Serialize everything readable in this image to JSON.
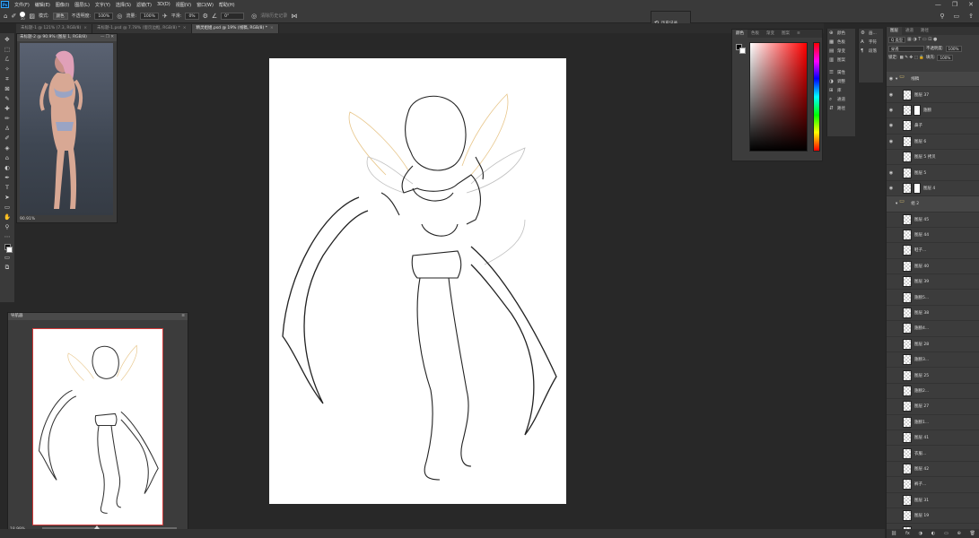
{
  "app": {
    "logo": "Ps",
    "window_controls": [
      "—",
      "❐",
      "✕"
    ]
  },
  "menu": [
    "文件(F)",
    "编辑(E)",
    "图像(I)",
    "图层(L)",
    "文字(Y)",
    "选择(S)",
    "滤镜(T)",
    "3D(D)",
    "视图(V)",
    "窗口(W)",
    "帮助(H)"
  ],
  "options": {
    "brush_size": "20",
    "mode_label": "模式:",
    "mode_value": "颜色",
    "opacity_label": "不透明度:",
    "opacity_value": "100%",
    "flow_label": "流量:",
    "flow_value": "100%",
    "smooth_label": "平滑:",
    "smooth_value": "0%",
    "angle_value": "0°",
    "extra_label": "清除历史记录"
  },
  "tabs": [
    {
      "label": "未标题-1 @ 121% (7.3, RGB/8)",
      "close": "×"
    },
    {
      "label": "未标题-1.psd @ 7.78% (窗页边框, RGB/8) *",
      "close": "×"
    },
    {
      "label": "精灵姐姐.psd @ 19% (线稿, RGB/8) *",
      "close": "×"
    }
  ],
  "toolbar_icons": [
    "✥",
    "⬚",
    "ℒ",
    "✧",
    "⌗",
    "⊠",
    "✎",
    "✚",
    "✏",
    "♙",
    "✐",
    "◈",
    "⌂",
    "◐",
    "✒",
    "T",
    "➤",
    "▭",
    "✋",
    "⚲",
    "⋯"
  ],
  "reference_window": {
    "title": "未标题-2 @ 90.9% (图层 1, RGB/8)",
    "zoom": "90.91%"
  },
  "navigator": {
    "title": "导航器",
    "zoom": "18.99%"
  },
  "history_panel": {
    "label": "历史记录",
    "icon": "history-icon"
  },
  "color_panel": {
    "tabs": [
      "颜色",
      "色板",
      "渐变",
      "图案"
    ],
    "fg_color": "#000000",
    "bg_color": "#ffffff",
    "hue_color": "#ff0000"
  },
  "dock_panels": [
    {
      "icon": "⊕",
      "label": "颜色"
    },
    {
      "icon": "▦",
      "label": "色板"
    },
    {
      "icon": "▤",
      "label": "渐变"
    },
    {
      "icon": "▥",
      "label": "图案"
    },
    {
      "icon": "☰",
      "label": "属性"
    },
    {
      "icon": "◑",
      "label": "调整"
    },
    {
      "icon": "⊞",
      "label": "库"
    },
    {
      "icon": "⌕",
      "label": "通道"
    },
    {
      "icon": "⇵",
      "label": "路径"
    }
  ],
  "dock2_panels": [
    {
      "icon": "⚙",
      "label": "画..."
    },
    {
      "icon": "A",
      "label": "字符"
    },
    {
      "icon": "¶",
      "label": "段落"
    }
  ],
  "layers_panel": {
    "tabs": [
      "图层",
      "通道",
      "路径"
    ],
    "filter_label": "Q 类型",
    "blend_mode": "穿透",
    "opacity_label": "不透明度:",
    "opacity_value": "100%",
    "lock_label": "锁定:",
    "fill_label": "填充:",
    "fill_value": "100%",
    "layers": [
      {
        "name": "线稿",
        "type": "group",
        "visible": true
      },
      {
        "name": "图层 37",
        "type": "layer",
        "visible": true,
        "mask": false
      },
      {
        "name": "翅膀",
        "type": "layer",
        "visible": true,
        "mask": true
      },
      {
        "name": "鼻子",
        "type": "layer",
        "visible": true,
        "mask": false
      },
      {
        "name": "图层 6",
        "type": "layer",
        "visible": true,
        "mask": false
      },
      {
        "name": "图层 5 拷贝",
        "type": "layer",
        "visible": false,
        "mask": false
      },
      {
        "name": "图层 5",
        "type": "layer",
        "visible": true,
        "mask": false
      },
      {
        "name": "图层 4",
        "type": "layer",
        "visible": true,
        "mask": true
      },
      {
        "name": "组 2",
        "type": "group",
        "visible": false
      },
      {
        "name": "图层 45",
        "type": "layer",
        "visible": false,
        "mask": false
      },
      {
        "name": "图层 44",
        "type": "layer",
        "visible": false,
        "mask": false
      },
      {
        "name": "鞋子...",
        "type": "layer",
        "visible": false,
        "mask": false
      },
      {
        "name": "图层 40",
        "type": "layer",
        "visible": false,
        "mask": false
      },
      {
        "name": "图层 39",
        "type": "layer",
        "visible": false,
        "mask": false
      },
      {
        "name": "翅膀5...",
        "type": "layer",
        "visible": false,
        "mask": false
      },
      {
        "name": "图层 38",
        "type": "layer",
        "visible": false,
        "mask": false
      },
      {
        "name": "翅膀4...",
        "type": "layer",
        "visible": false,
        "mask": false
      },
      {
        "name": "图层 28",
        "type": "layer",
        "visible": false,
        "mask": false
      },
      {
        "name": "翅膀3...",
        "type": "layer",
        "visible": false,
        "mask": false
      },
      {
        "name": "图层 25",
        "type": "layer",
        "visible": false,
        "mask": false
      },
      {
        "name": "翅膀2...",
        "type": "layer",
        "visible": false,
        "mask": false
      },
      {
        "name": "图层 27",
        "type": "layer",
        "visible": false,
        "mask": false
      },
      {
        "name": "翅膀1...",
        "type": "layer",
        "visible": false,
        "mask": false
      },
      {
        "name": "图层 41",
        "type": "layer",
        "visible": false,
        "mask": false
      },
      {
        "name": "衣服...",
        "type": "layer",
        "visible": false,
        "mask": false
      },
      {
        "name": "图层 42",
        "type": "layer",
        "visible": false,
        "mask": false
      },
      {
        "name": "裤子...",
        "type": "layer",
        "visible": false,
        "mask": false
      },
      {
        "name": "图层 31",
        "type": "layer",
        "visible": false,
        "mask": false
      },
      {
        "name": "图层 19",
        "type": "layer",
        "visible": false,
        "mask": false
      },
      {
        "name": "图层 22",
        "type": "layer",
        "visible": false,
        "mask": false
      }
    ],
    "bottom_icons": [
      "⛓",
      "fx",
      "◑",
      "◐",
      "▭",
      "⊕",
      "🗑"
    ]
  }
}
